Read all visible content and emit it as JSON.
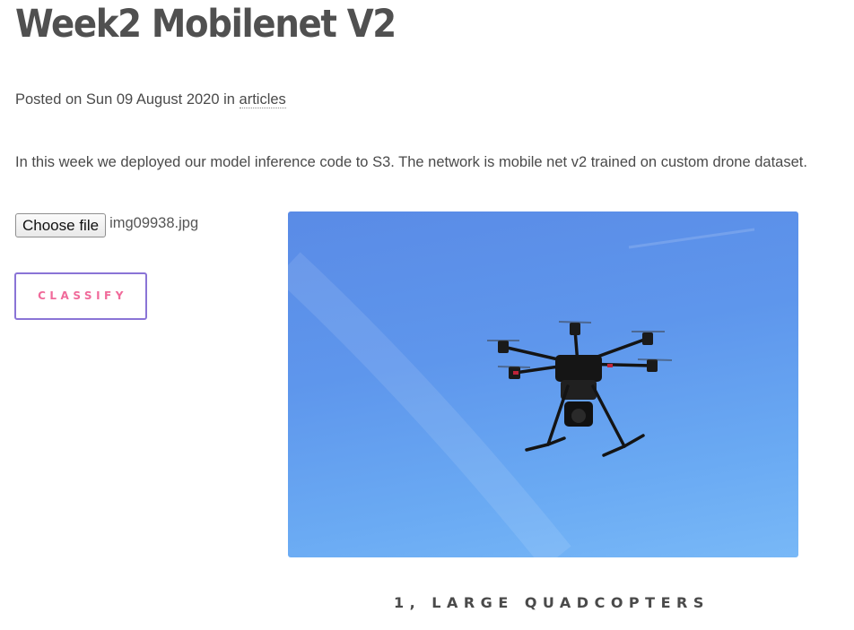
{
  "post": {
    "title": "Week2 Mobilenet V2",
    "meta_prefix": "Posted on Sun 09 August 2020 in ",
    "category_link": "articles",
    "description": "In this week we deployed our model inference code to S3. The network is mobile net v2 trained on custom drone dataset."
  },
  "upload": {
    "choose_file_label": "Choose file",
    "selected_file": "img09938.jpg",
    "classify_label": "CLASSIFY"
  },
  "preview": {
    "subject": "hexacopter drone against blue sky"
  },
  "result": {
    "text": "1, LARGE QUADCOPTERS"
  },
  "colors": {
    "text": "#4a4a4a",
    "classify_border": "#8a74d6",
    "classify_text": "#f06a9a",
    "sky": "#5e96ec"
  }
}
